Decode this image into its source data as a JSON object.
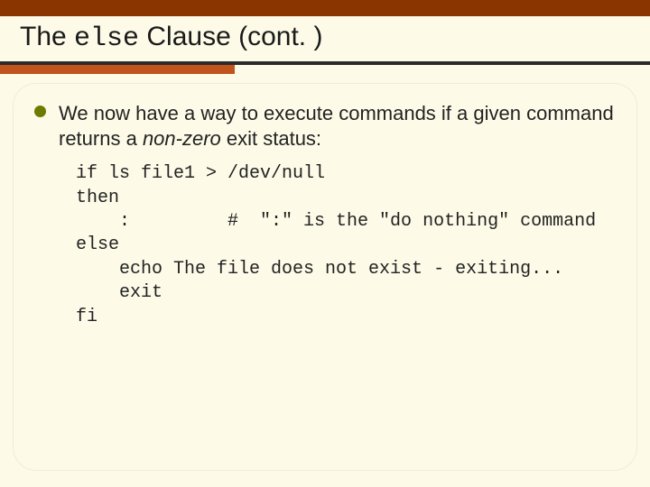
{
  "slide": {
    "title_prefix": "The ",
    "title_code": "else",
    "title_suffix": " Clause (cont. )",
    "bullet_part1": "We now have a way to execute commands if a given command returns a ",
    "bullet_italic": "non-zero",
    "bullet_part2": " exit status:",
    "code": "if ls file1 > /dev/null\nthen\n    :         #  \":\" is the \"do nothing\" command\nelse\n    echo The file does not exist - exiting...\n    exit\nfi"
  }
}
